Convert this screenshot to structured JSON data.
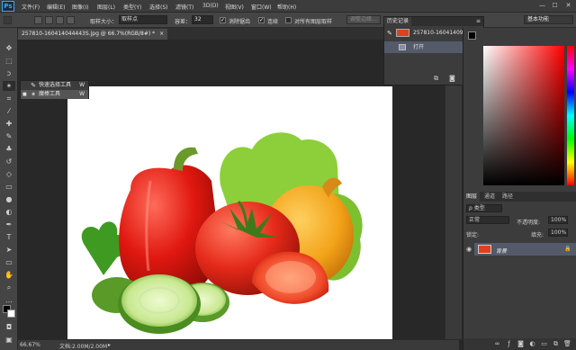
{
  "app": {
    "logo": "Ps"
  },
  "menu": [
    "文件(F)",
    "编辑(E)",
    "图像(I)",
    "图层(L)",
    "类型(Y)",
    "选择(S)",
    "滤镜(T)",
    "3D(D)",
    "视图(V)",
    "窗口(W)",
    "帮助(H)"
  ],
  "window_controls": {
    "minimize": "—",
    "maximize": "☐",
    "close": "✕"
  },
  "options": {
    "sample_size_label": "取样大小：",
    "sample_size_value": "取样点",
    "tolerance_label": "容差：",
    "tolerance_value": "32",
    "antialias_label": "消除锯齿",
    "antialias_checked": "✓",
    "contiguous_label": "连续",
    "contiguous_checked": "✓",
    "all_layers_label": "对所有图层取样",
    "refine_edge_label": "调整边缘...",
    "workspace_value": "基本功能"
  },
  "document": {
    "tab_title": "257810-160414044443S.jpg @ 66.7%(RGB/8#) *",
    "tab_close": "×"
  },
  "tool_flyout": {
    "items": [
      {
        "label": "快速选择工具",
        "key": "W",
        "icon": "quick-selection-icon",
        "glyph": "✎"
      },
      {
        "label": "魔棒工具",
        "key": "W",
        "icon": "magic-wand-icon",
        "glyph": "✶",
        "selected": true
      }
    ]
  },
  "history": {
    "tab": "历史记录",
    "snapshot": "257810-16041409444...",
    "steps": [
      "打开"
    ]
  },
  "status": {
    "zoom": "66.67%",
    "doc_info": "文档:2.00M/2.00M",
    "arrow": "▸"
  },
  "layers_panel": {
    "tabs": [
      "图层",
      "通道",
      "路径"
    ],
    "filter_kind": "ρ 类型",
    "blend_mode": "正常",
    "opacity_label": "不透明度:",
    "opacity_value": "100%",
    "lock_label": "锁定:",
    "fill_label": "填充:",
    "fill_value": "100%",
    "layer_name": "背景",
    "lock_icon": "🔒"
  },
  "colors": {
    "accent": "#31a8ff",
    "selected_row": "#545a6a"
  }
}
